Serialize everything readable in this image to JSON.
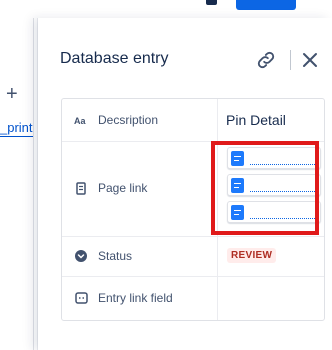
{
  "background": {
    "add_symbol": "+",
    "link_text": "_print"
  },
  "panel": {
    "title": "Database entry",
    "link_icon": "link-icon",
    "close_icon": "close-icon"
  },
  "table": {
    "header": {
      "field_label": "Decsription",
      "field_icon": "text-aa-icon",
      "column": "Pin Detail"
    },
    "rows": [
      {
        "label": "Page link",
        "icon": "page-icon",
        "links": [
          {
            "icon": "document-icon",
            "text": ""
          },
          {
            "icon": "document-icon",
            "text": ""
          },
          {
            "icon": "document-icon",
            "text": ""
          }
        ]
      },
      {
        "label": "Status",
        "icon": "status-chevron-icon",
        "value": "REVIEW"
      },
      {
        "label": "Entry link field",
        "icon": "link-field-icon",
        "value": ""
      }
    ]
  },
  "colors": {
    "accent": "#0c66e4",
    "status_review_text": "#ae2e24",
    "status_review_bg": "#ffeceb",
    "annotation": "#e01a1a"
  }
}
